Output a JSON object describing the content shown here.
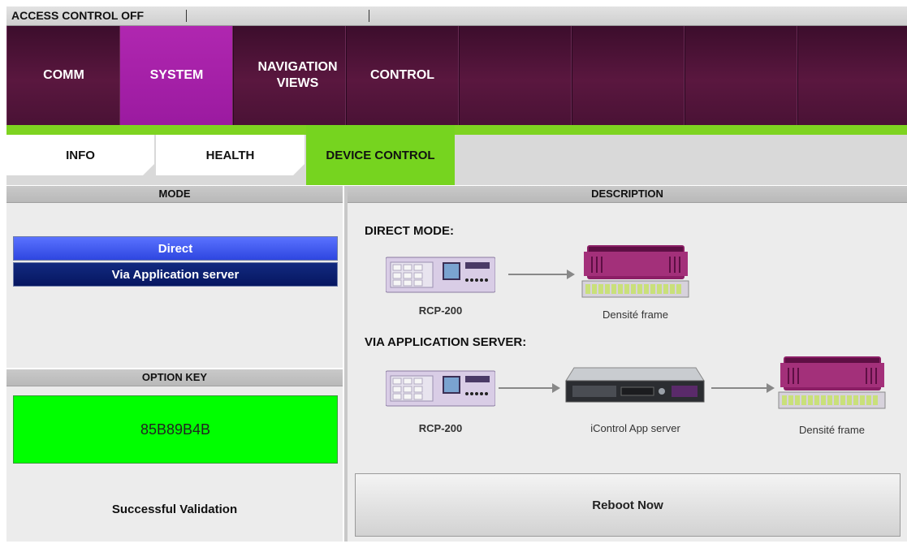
{
  "status_bar": {
    "text": "ACCESS CONTROL OFF"
  },
  "main_nav": {
    "tabs": [
      {
        "label": "COMM"
      },
      {
        "label": "SYSTEM",
        "active": true
      },
      {
        "label": "NAVIGATION\nVIEWS"
      },
      {
        "label": "CONTROL"
      },
      {
        "label": ""
      },
      {
        "label": ""
      },
      {
        "label": ""
      },
      {
        "label": ""
      }
    ]
  },
  "sub_nav": {
    "tabs": [
      {
        "label": "INFO"
      },
      {
        "label": "HEALTH"
      },
      {
        "label": "DEVICE CONTROL",
        "active": true
      }
    ]
  },
  "mode_panel": {
    "header": "MODE",
    "options": [
      {
        "label": "Direct",
        "selected": true
      },
      {
        "label": "Via Application server",
        "selected": false
      }
    ]
  },
  "option_key_panel": {
    "header": "OPTION KEY",
    "key": "85B89B4B",
    "status": "Successful Validation"
  },
  "description_panel": {
    "header": "DESCRIPTION",
    "direct_mode": {
      "title": "DIRECT MODE:",
      "source_label": "RCP-200",
      "target_label": "Densité frame"
    },
    "via_server": {
      "title": "VIA APPLICATION SERVER:",
      "source_label": "RCP-200",
      "server_label": "iControl App server",
      "target_label": "Densité frame"
    }
  },
  "reboot_button": {
    "label": "Reboot Now"
  },
  "colors": {
    "nav_bg": "#4a1235",
    "nav_active": "#a020a8",
    "subnav_active": "#76d41f",
    "option_key_bg": "#00ff00",
    "mode_selected": "#3f55f0",
    "mode_unselected": "#0a1f6e"
  }
}
